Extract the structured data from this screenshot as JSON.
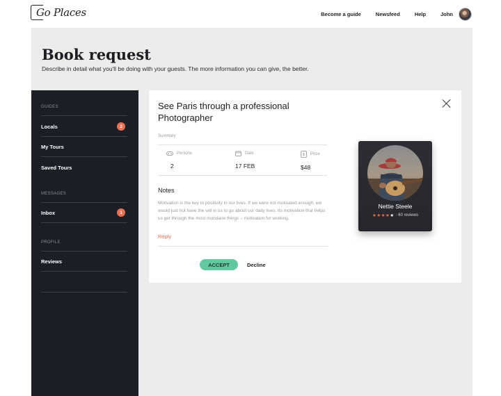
{
  "brand": {
    "name": "Go Places"
  },
  "nav": {
    "links": [
      "Become a guide",
      "Newsfeed",
      "Help"
    ],
    "user_name": "John"
  },
  "header": {
    "title": "Book request",
    "subtitle": "Describe in detail what you'll be doing with your guests. The more information you can give, the better."
  },
  "sidebar": {
    "sections": [
      {
        "title": "GUIDES",
        "items": [
          {
            "label": "Locals",
            "badge": "2"
          },
          {
            "label": "My Tours"
          },
          {
            "label": "Saved Tours"
          }
        ]
      },
      {
        "title": "MESSAGES",
        "items": [
          {
            "label": "Inbox",
            "badge": "1"
          }
        ]
      },
      {
        "title": "PROFILE",
        "items": [
          {
            "label": "Reviews"
          }
        ]
      }
    ]
  },
  "request": {
    "title": "See Paris through a professional Photographer",
    "summary_label": "Summary",
    "stats": [
      {
        "label": "Persons",
        "value": "2",
        "icon": "gamepad-icon"
      },
      {
        "label": "Date",
        "value": "17 FEB",
        "icon": "calendar-icon"
      },
      {
        "label": "Price",
        "value": "$48",
        "icon": "price-tag-icon"
      }
    ],
    "notes_title": "Notes",
    "notes_body": "Motivation is the key to positivity in our lives. If we were not motivated enough, we would just not have the will in us to go about our daily lives. Its motivation that helps us get through the most mundane things – motivation for working.",
    "reply_label": "Reply",
    "accept_label": "ACCEPT",
    "decline_label": "Decline"
  },
  "guide": {
    "name": "Nettie Steele",
    "rating": 4,
    "rating_max": 5,
    "reviews_text": "· 60 reviews"
  },
  "colors": {
    "accent": "#ea6e52",
    "accept": "#62c8a0",
    "sidebar_bg": "#1c1e26",
    "page_bg": "#ececea"
  }
}
